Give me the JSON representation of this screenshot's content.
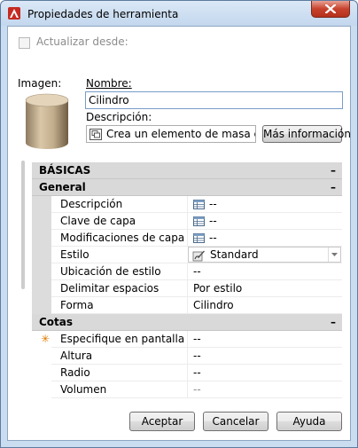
{
  "window": {
    "title": "Propiedades de herramienta"
  },
  "update_from": {
    "label": "Actualizar desde:",
    "checked": false
  },
  "image_label": "Imagen:",
  "name": {
    "label": "Nombre:",
    "value": "Cilindro"
  },
  "description": {
    "label": "Descripción:",
    "value": "Crea un elemento de masa cilin",
    "more_info_button": "Más información"
  },
  "sections": {
    "basic": {
      "title": "BÁSICAS",
      "toggle": "–"
    },
    "general": {
      "title": "General",
      "toggle": "–",
      "rows": [
        {
          "name": "Descripción",
          "value": "--"
        },
        {
          "name": "Clave de capa",
          "value": "--"
        },
        {
          "name": "Modificaciones de capa",
          "value": "--"
        },
        {
          "name": "Estilo",
          "value": "Standard"
        },
        {
          "name": "Ubicación de estilo",
          "value": "--"
        },
        {
          "name": "Delimitar espacios",
          "value": "Por estilo"
        },
        {
          "name": "Forma",
          "value": "Cilindro"
        }
      ]
    },
    "dimensions": {
      "title": "Cotas",
      "toggle": "–",
      "rows": [
        {
          "name": "Especifique en pantalla",
          "value": "--",
          "marker": "✳"
        },
        {
          "name": "Altura",
          "value": "--"
        },
        {
          "name": "Radio",
          "value": "--"
        },
        {
          "name": "Volumen",
          "value": "--"
        }
      ]
    }
  },
  "buttons": {
    "ok": "Aceptar",
    "cancel": "Cancelar",
    "help": "Ayuda"
  },
  "colors": {
    "accent_red": "#c7432d",
    "title_bar": "#c9dcf0",
    "section_bg": "#d9d9d9"
  },
  "icons": [
    "app-logo-icon",
    "close-icon",
    "description-icon",
    "table-icon",
    "style-icon",
    "chevron-down-icon"
  ]
}
